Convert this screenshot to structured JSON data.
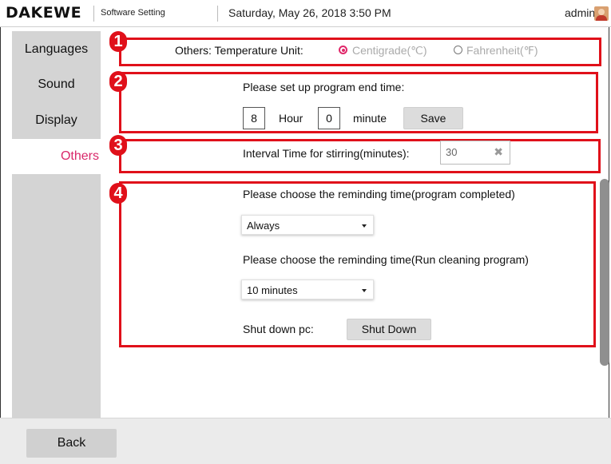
{
  "header": {
    "brand": "DAKEWE",
    "app_title": "Software Setting",
    "datetime": "Saturday, May 26, 2018 3:50 PM",
    "user": "admin",
    "avatar_icon": "user-avatar-icon"
  },
  "sidebar": {
    "items": [
      {
        "label": "Languages",
        "active": false
      },
      {
        "label": "Sound",
        "active": false
      },
      {
        "label": "Display",
        "active": false
      },
      {
        "label": "Others",
        "active": true
      }
    ]
  },
  "annotations": {
    "badges": [
      "1",
      "2",
      "3",
      "4"
    ],
    "color": "#e0101a"
  },
  "sections": {
    "temperature": {
      "label": "Others: Temperature Unit:",
      "options": [
        {
          "label": "Centigrade(℃)",
          "selected": true
        },
        {
          "label": "Fahrenheit(℉)",
          "selected": false
        }
      ]
    },
    "end_time": {
      "prompt": "Please set up program end time:",
      "hour_value": "8",
      "hour_label": "Hour",
      "minute_value": "0",
      "minute_label": "minute",
      "save_label": "Save"
    },
    "stirring": {
      "label": "Interval Time for stirring(minutes):",
      "value": "30",
      "clear_icon": "clear-x-icon"
    },
    "reminders": {
      "completed_prompt": "Please choose the reminding time(program completed)",
      "completed_value": "Always",
      "cleaning_prompt": "Please choose the reminding time(Run cleaning program)",
      "cleaning_value": "10 minutes",
      "shutdown_label": "Shut down pc:",
      "shutdown_button": "Shut Down"
    }
  },
  "footer": {
    "back_label": "Back"
  },
  "colors": {
    "accent": "#d9286a",
    "sidebar_bg": "#d4d4d4",
    "annotation": "#e0101a"
  }
}
